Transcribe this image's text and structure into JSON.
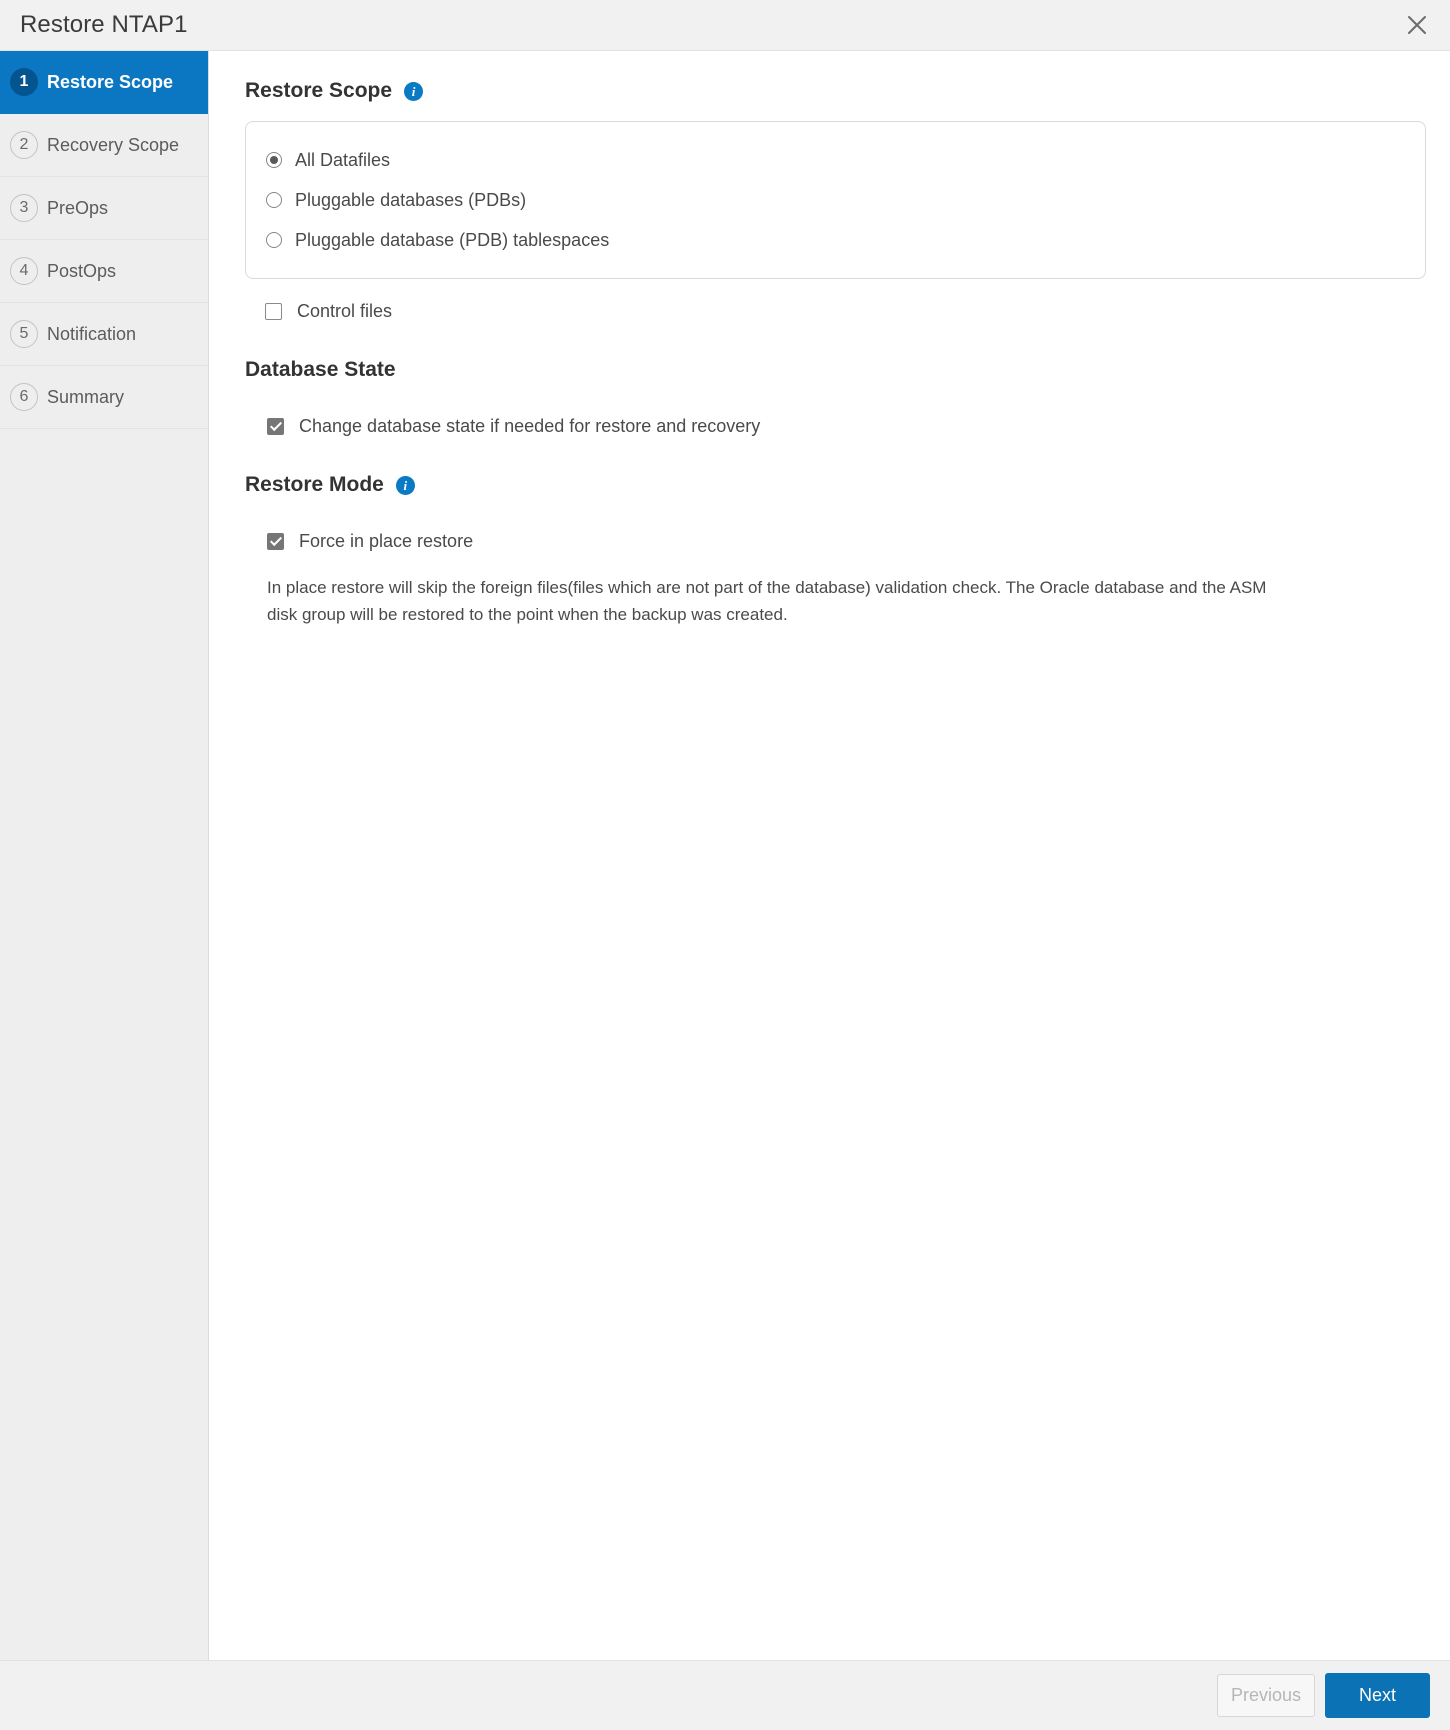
{
  "titlebar": {
    "title": "Restore NTAP1",
    "close_icon": "close-icon"
  },
  "sidebar": {
    "items": [
      {
        "num": "1",
        "label": "Restore Scope",
        "active": true
      },
      {
        "num": "2",
        "label": "Recovery Scope",
        "active": false
      },
      {
        "num": "3",
        "label": "PreOps",
        "active": false
      },
      {
        "num": "4",
        "label": "PostOps",
        "active": false
      },
      {
        "num": "5",
        "label": "Notification",
        "active": false
      },
      {
        "num": "6",
        "label": "Summary",
        "active": false
      }
    ]
  },
  "content": {
    "restore_scope": {
      "heading": "Restore Scope",
      "info_icon": "info-icon",
      "options": [
        {
          "label": "All Datafiles",
          "selected": true
        },
        {
          "label": "Pluggable databases (PDBs)",
          "selected": false
        },
        {
          "label": "Pluggable database (PDB) tablespaces",
          "selected": false
        }
      ],
      "control_files": {
        "label": "Control files",
        "checked": false
      }
    },
    "database_state": {
      "heading": "Database State",
      "change_state": {
        "label": "Change database state if needed for restore and recovery",
        "checked": true
      }
    },
    "restore_mode": {
      "heading": "Restore Mode",
      "info_icon": "info-icon",
      "force_in_place": {
        "label": "Force in place restore",
        "checked": true
      },
      "description": "In place restore will skip the foreign files(files which are not part of the database) validation check. The Oracle database and the ASM disk group will be restored to the point when the backup was created."
    }
  },
  "footer": {
    "previous_label": "Previous",
    "next_label": "Next"
  },
  "colors": {
    "accent": "#0b77c2",
    "next_button": "#0b72b5",
    "active_step_circle": "#04558f",
    "info_icon": "#0a7ac4",
    "sidebar_bg": "#eeeeee",
    "titlebar_bg": "#f1f1f1"
  }
}
